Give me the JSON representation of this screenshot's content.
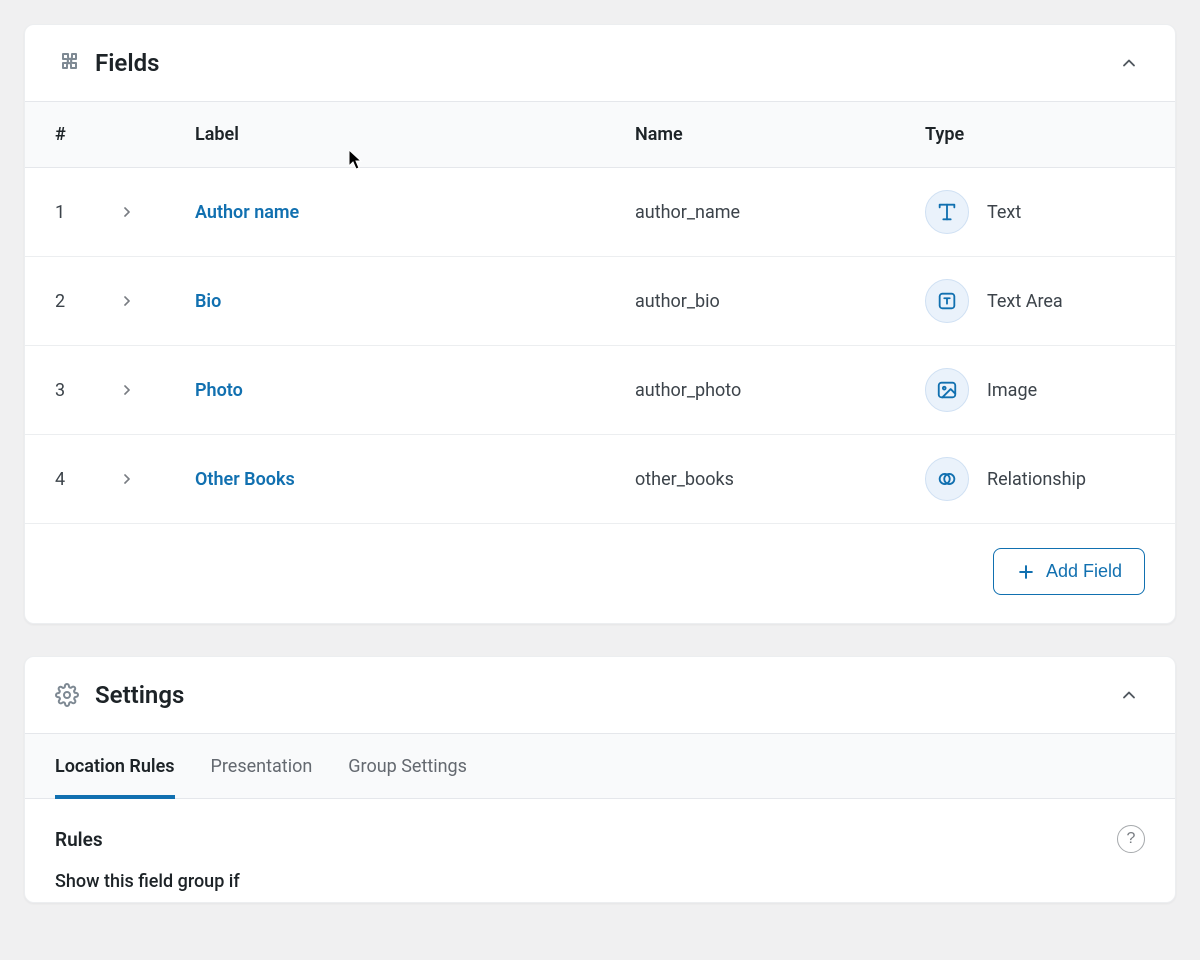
{
  "fields_panel": {
    "title": "Fields",
    "columns": {
      "num": "#",
      "label": "Label",
      "name": "Name",
      "type": "Type"
    },
    "rows": [
      {
        "num": "1",
        "label": "Author name",
        "name": "author_name",
        "type": "Text",
        "icon": "text"
      },
      {
        "num": "2",
        "label": "Bio",
        "name": "author_bio",
        "type": "Text Area",
        "icon": "textarea"
      },
      {
        "num": "3",
        "label": "Photo",
        "name": "author_photo",
        "type": "Image",
        "icon": "image"
      },
      {
        "num": "4",
        "label": "Other Books",
        "name": "other_books",
        "type": "Relationship",
        "icon": "relationship"
      }
    ],
    "add_btn": "Add Field"
  },
  "settings_panel": {
    "title": "Settings",
    "tabs": [
      {
        "label": "Location Rules",
        "active": true
      },
      {
        "label": "Presentation",
        "active": false
      },
      {
        "label": "Group Settings",
        "active": false
      }
    ],
    "rules_heading": "Rules",
    "rules_description": "Show this field group if"
  }
}
